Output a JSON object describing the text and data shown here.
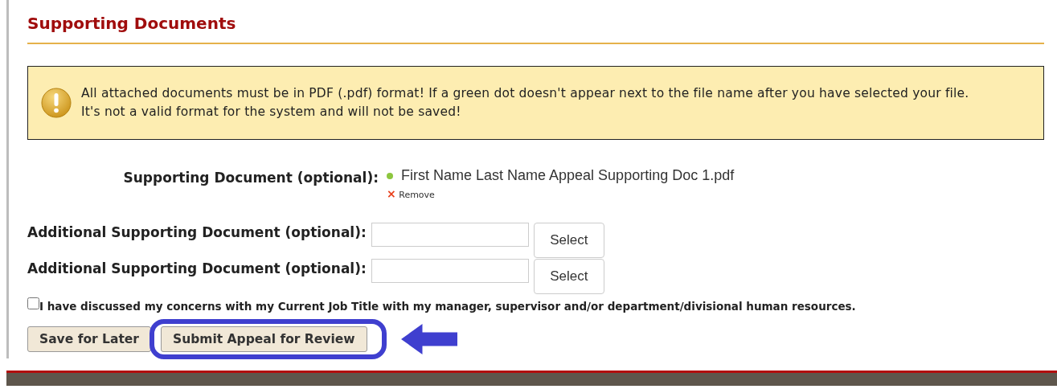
{
  "section": {
    "title": "Supporting Documents"
  },
  "alert": {
    "lines": [
      "All attached documents must be in PDF (.pdf) format! If a green dot doesn't appear next to the file name after you have selected your file.",
      "It's not a valid format for the system and will not be saved!"
    ]
  },
  "uploaded": {
    "label": "Supporting Document (optional):",
    "file_name": "First Name Last Name Appeal Supporting Doc 1.pdf",
    "valid": true,
    "remove_icon": "×",
    "remove_label": "Remove"
  },
  "additional": [
    {
      "label": "Additional Supporting Document (optional):",
      "button": "Select"
    },
    {
      "label": "Additional Supporting Document (optional):",
      "button": "Select"
    }
  ],
  "acknowledgement": {
    "checked": false,
    "label": "I have discussed my concerns with my Current Job Title with my manager, supervisor and/or department/divisional human resources."
  },
  "buttons": [
    {
      "label": "Save for Later",
      "highlighted": false
    },
    {
      "label": "Submit Appeal for Review",
      "highlighted": true
    }
  ]
}
